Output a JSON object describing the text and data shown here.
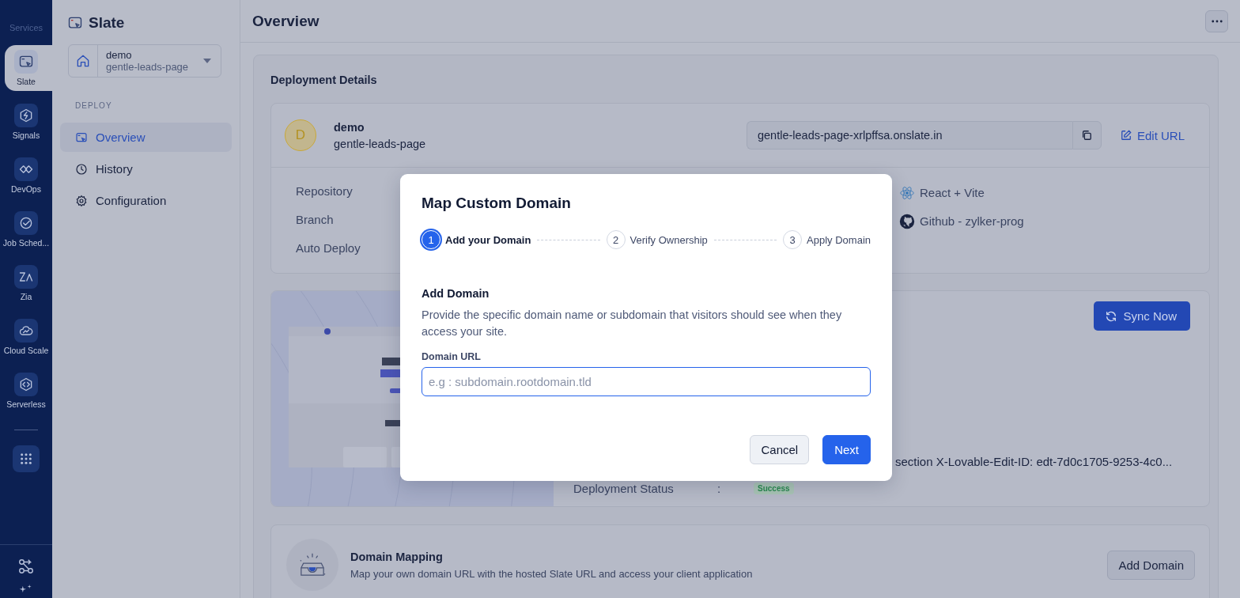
{
  "rail": {
    "label": "Services",
    "items": [
      {
        "label": "Slate",
        "selected": true
      },
      {
        "label": "Signals",
        "selected": false
      },
      {
        "label": "DevOps",
        "selected": false
      },
      {
        "label": "Job Sched...",
        "selected": false
      },
      {
        "label": "Zia",
        "selected": false
      },
      {
        "label": "Cloud Scale",
        "selected": false
      },
      {
        "label": "Serverless",
        "selected": false
      }
    ]
  },
  "sidebar": {
    "title": "Slate",
    "project": {
      "name": "demo",
      "slug": "gentle-leads-page"
    },
    "section": "DEPLOY",
    "items": [
      {
        "label": "Overview",
        "selected": true
      },
      {
        "label": "History",
        "selected": false
      },
      {
        "label": "Configuration",
        "selected": false
      }
    ]
  },
  "header": {
    "title": "Overview"
  },
  "deployment": {
    "title": "Deployment Details",
    "app": {
      "initial": "D",
      "name": "demo",
      "slug": "gentle-leads-page"
    },
    "url": "gentle-leads-page-xrlpffsa.onslate.in",
    "edit": "Edit URL",
    "labels": [
      "Repository",
      "Branch",
      "Auto Deploy"
    ],
    "values": [
      "React + Vite",
      "Github - zylker-prog"
    ]
  },
  "build": {
    "sync": "Sync Now",
    "commit": "section X-Lovable-Edit-ID: edt-7d0c1705-9253-4c0...",
    "status_label": "Deployment Status",
    "colon": ":",
    "status": "Success"
  },
  "domain_mapping": {
    "title": "Domain Mapping",
    "description": "Map your own domain URL with the hosted Slate URL and access your client application",
    "button": "Add Domain"
  },
  "modal": {
    "title": "Map Custom Domain",
    "steps": [
      {
        "number": "1",
        "label": "Add your Domain",
        "selected": true
      },
      {
        "number": "2",
        "label": "Verify Ownership",
        "selected": false
      },
      {
        "number": "3",
        "label": "Apply Domain",
        "selected": false
      }
    ],
    "section": "Add Domain",
    "description": "Provide the specific domain name or subdomain that visitors should see when they access your site.",
    "field_label": "Domain URL",
    "placeholder": "e.g : subdomain.rootdomain.tld",
    "buttons": [
      {
        "label": "Cancel",
        "kind": "secondary"
      },
      {
        "label": "Next",
        "kind": "primary"
      }
    ]
  }
}
